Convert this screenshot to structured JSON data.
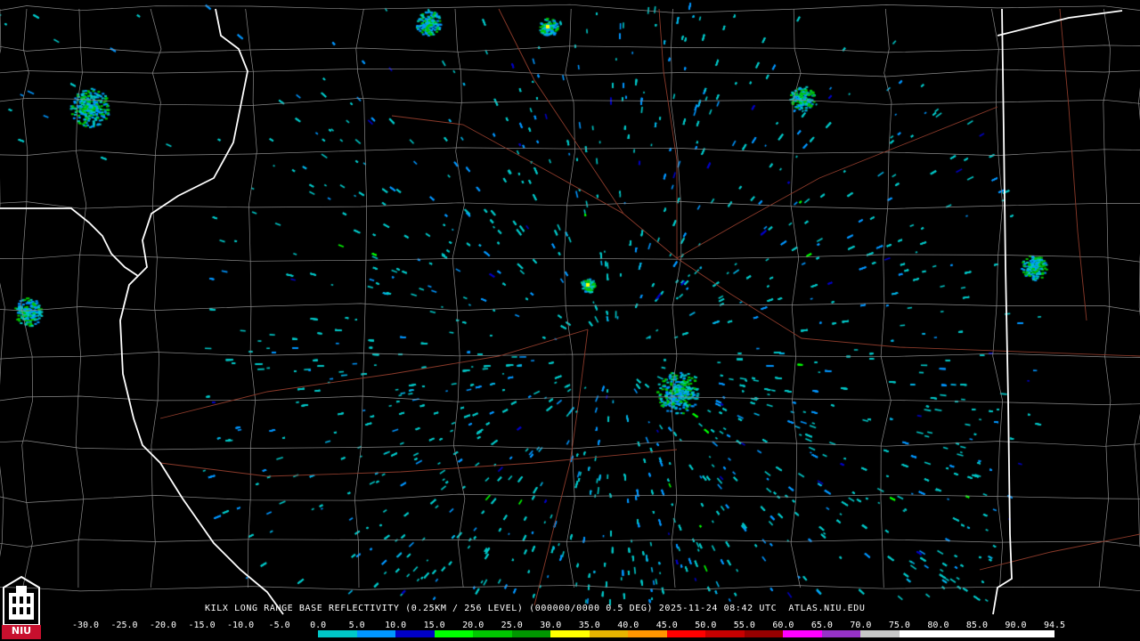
{
  "header": {
    "product_title": "KILX LONG RANGE BASE REFLECTIVITY (0.25KM / 256 LEVEL) (000000/0000 0.5 DEG) 2025-11-24 08:42 UTC  ATLAS.NIU.EDU"
  },
  "logo": {
    "text": "NIU",
    "color": "#c8102e"
  },
  "legend": {
    "tick_labels": [
      "-30.0",
      "-25.0",
      "-20.0",
      "-15.0",
      "-10.0",
      "-5.0",
      "0.0",
      "5.0",
      "10.0",
      "15.0",
      "20.0",
      "25.0",
      "30.0",
      "35.0",
      "40.0",
      "45.0",
      "50.0",
      "55.0",
      "60.0",
      "65.0",
      "70.0",
      "75.0",
      "80.0",
      "85.0",
      "90.0",
      "94.5"
    ],
    "colors": [
      "#000000",
      "#000000",
      "#000000",
      "#000000",
      "#000000",
      "#000000",
      "#00c8c8",
      "#0096ff",
      "#0000c8",
      "#00ff00",
      "#00c800",
      "#009600",
      "#ffff00",
      "#e6b400",
      "#ff9600",
      "#ff0000",
      "#c80000",
      "#960000",
      "#ff00ff",
      "#9632c8",
      "#c8c8c8",
      "#ffffff",
      "#ffffff",
      "#ffffff",
      "#ffffff"
    ]
  },
  "map_colors": {
    "background": "#000000",
    "state_border": "#ffffff",
    "county_line": "#8a8a8a",
    "highway": "#8b3a2a"
  }
}
